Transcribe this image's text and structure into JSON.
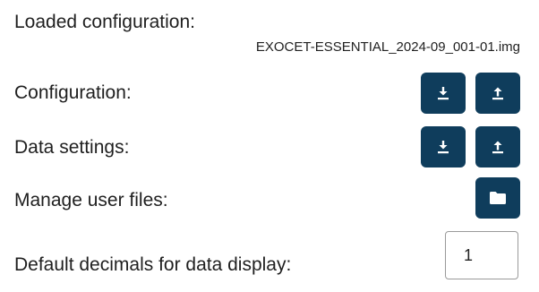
{
  "loaded_configuration": {
    "label": "Loaded configuration:",
    "filename": "EXOCET-ESSENTIAL_2024-09_001-01.img"
  },
  "configuration": {
    "label": "Configuration:",
    "download_icon": "download-icon",
    "upload_icon": "upload-icon"
  },
  "data_settings": {
    "label": "Data settings:",
    "download_icon": "download-icon",
    "upload_icon": "upload-icon"
  },
  "user_files": {
    "label": "Manage user files:",
    "folder_icon": "folder-icon"
  },
  "default_decimals": {
    "label": "Default decimals for data display:",
    "value": "1"
  },
  "colors": {
    "button_bg": "#0f3d5c",
    "icon": "#ffffff",
    "text": "#1f1f1f"
  }
}
